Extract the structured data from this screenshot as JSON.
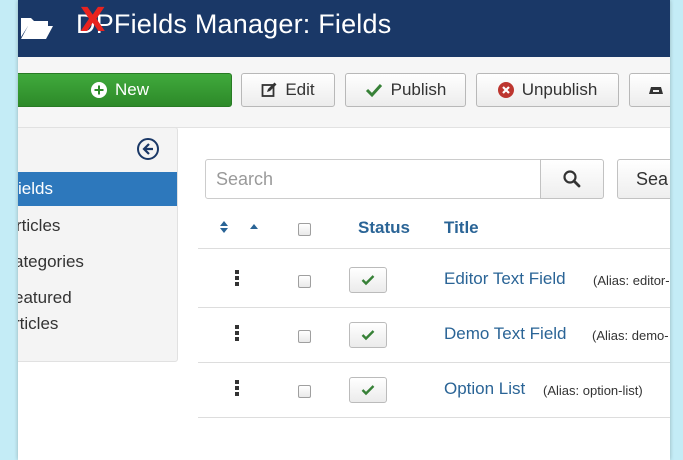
{
  "header": {
    "title_prefix": "D",
    "title_strike": "X",
    "title_rest": "PFields Manager: Fields",
    "icon": "folder-open-icon",
    "colors": {
      "bar": "#1a3867",
      "strike": "#e8231f"
    }
  },
  "toolbar": {
    "new_label": "New",
    "edit_label": "Edit",
    "publish_label": "Publish",
    "unpublish_label": "Unpublish",
    "icons": [
      "plus-circle-icon",
      "edit-icon",
      "check-icon",
      "x-circle-icon",
      "archive-icon"
    ]
  },
  "sidebar": {
    "collapse_icon": "arrow-left-circle-icon",
    "items": [
      {
        "label": "ields",
        "active": true
      },
      {
        "label": "rticles",
        "active": false
      },
      {
        "label": "ategories",
        "active": false
      },
      {
        "label": "eatured",
        "label2": "rticles",
        "active": false
      }
    ]
  },
  "search": {
    "placeholder": "Search",
    "button_icon": "search-icon",
    "tools_label": "Sea"
  },
  "table": {
    "headers": {
      "status": "Status",
      "title": "Title"
    },
    "rows": [
      {
        "title": "Editor Text Field",
        "alias": "(Alias: editor-",
        "published": true
      },
      {
        "title": "Demo Text Field",
        "alias": "(Alias: demo-",
        "published": true
      },
      {
        "title": "Option List",
        "alias": "(Alias: option-list)",
        "published": true
      }
    ]
  }
}
